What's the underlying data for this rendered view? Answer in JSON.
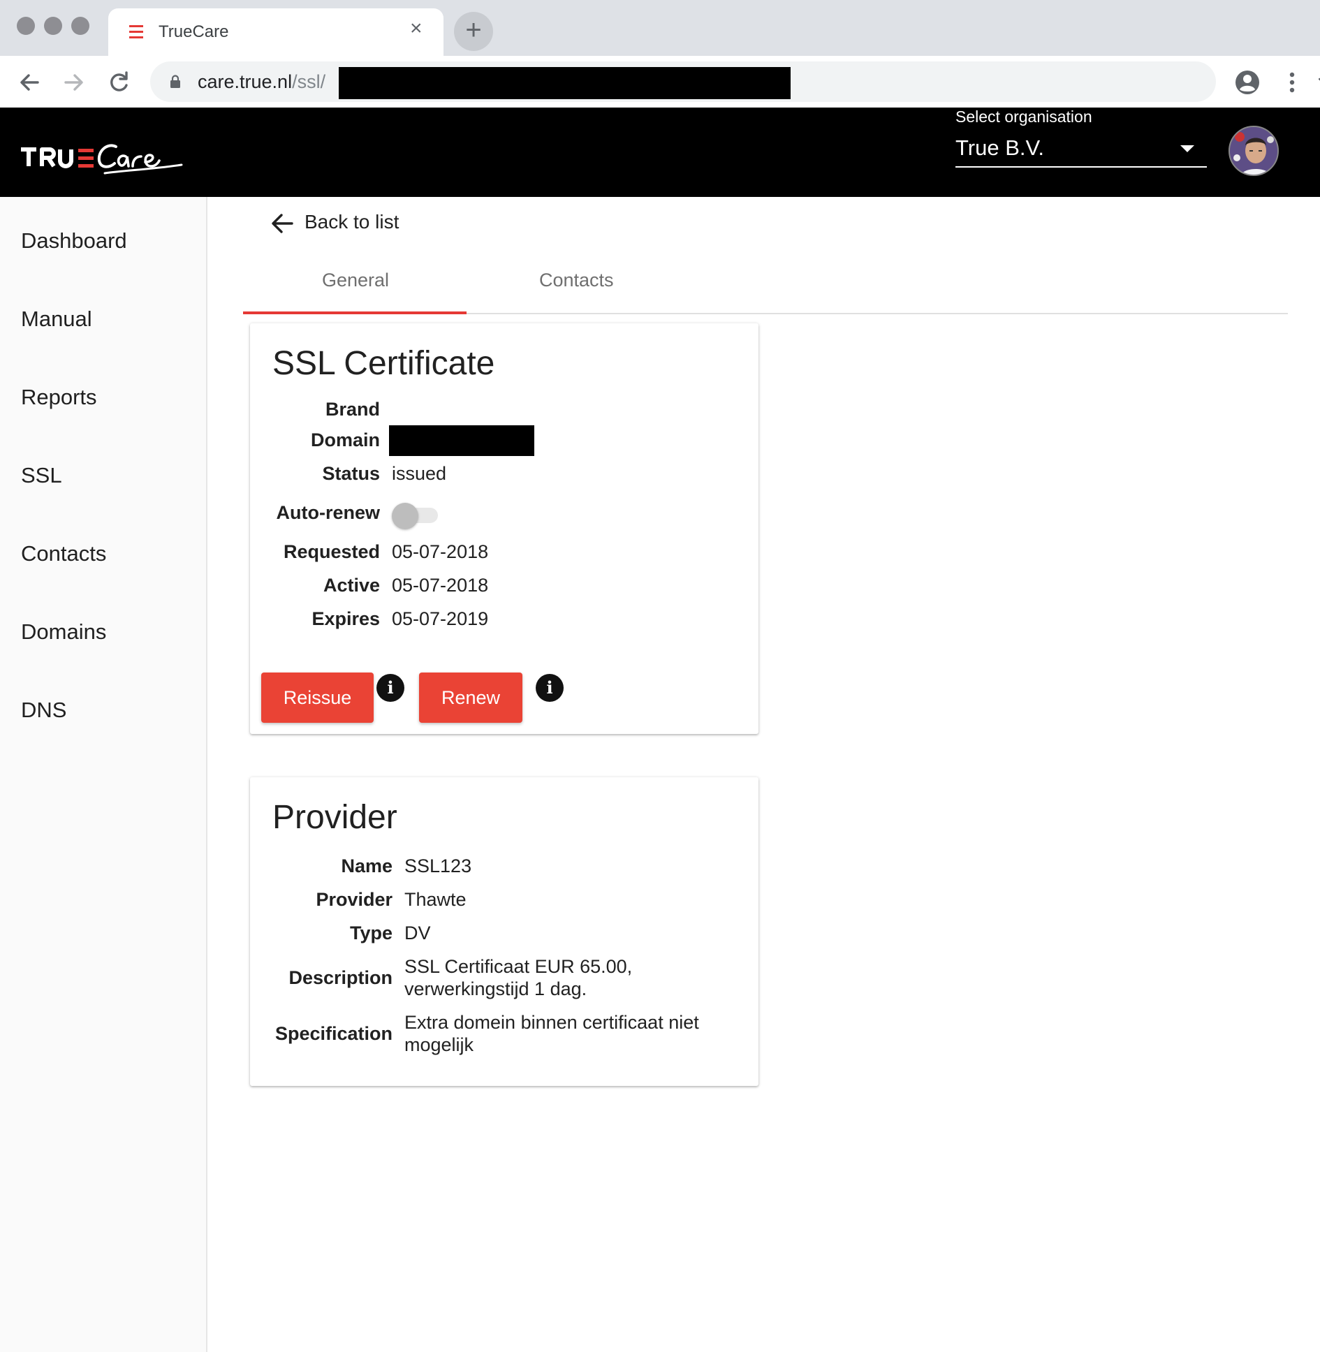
{
  "browser": {
    "tab_title": "TrueCare",
    "url_host": "care.true.nl",
    "url_path": "/ssl/"
  },
  "header": {
    "org_label": "Select organisation",
    "org_value": "True B.V."
  },
  "sidebar": {
    "items": [
      {
        "label": "Dashboard"
      },
      {
        "label": "Manual"
      },
      {
        "label": "Reports"
      },
      {
        "label": "SSL"
      },
      {
        "label": "Contacts"
      },
      {
        "label": "Domains"
      },
      {
        "label": "DNS"
      }
    ]
  },
  "back_label": "Back to list",
  "tabs": [
    {
      "label": "General"
    },
    {
      "label": "Contacts"
    }
  ],
  "ssl": {
    "title": "SSL Certificate",
    "labels": {
      "brand": "Brand",
      "domain": "Domain",
      "status": "Status",
      "autorenew": "Auto-renew",
      "requested": "Requested",
      "active": "Active",
      "expires": "Expires"
    },
    "values": {
      "brand": "",
      "status": "issued",
      "autorenew": false,
      "requested": "05-07-2018",
      "active": "05-07-2018",
      "expires": "05-07-2019"
    },
    "reissue_label": "Reissue",
    "renew_label": "Renew",
    "info_glyph": "i"
  },
  "provider": {
    "title": "Provider",
    "labels": {
      "name": "Name",
      "provider": "Provider",
      "type": "Type",
      "description": "Description",
      "specification": "Specification"
    },
    "values": {
      "name": "SSL123",
      "provider": "Thawte",
      "type": "DV",
      "description_line1": "SSL Certificaat EUR 65.00,",
      "description_line2": "verwerkingstijd 1 dag.",
      "specification_line1": "Extra domein binnen certificaat niet",
      "specification_line2": "mogelijk"
    }
  },
  "colors": {
    "accent": "#ea4335",
    "header_bg": "#000000",
    "tabstrip_bg": "#dee1e6"
  }
}
